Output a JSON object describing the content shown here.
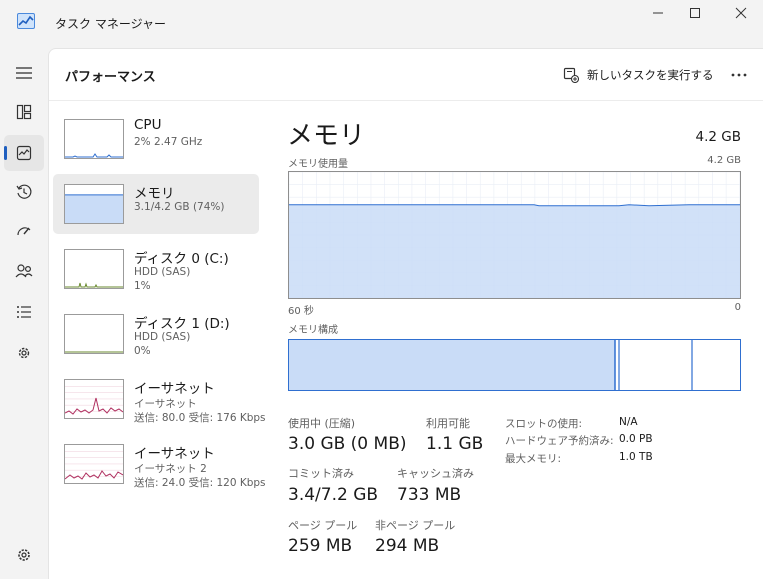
{
  "window": {
    "title": "タスク マネージャー"
  },
  "header": {
    "title": "パフォーマンス",
    "new_task_label": "新しいタスクを実行する"
  },
  "colors": {
    "accent": "#1f5fbf",
    "memory_fill": "#c9dcf7",
    "memory_line": "#2f6fd0",
    "network_line": "#b03060"
  },
  "nav": {
    "items": [
      {
        "icon": "hamburger-menu-icon"
      },
      {
        "icon": "processes-icon"
      },
      {
        "icon": "performance-icon",
        "active": true
      },
      {
        "icon": "app-history-icon"
      },
      {
        "icon": "startup-apps-icon"
      },
      {
        "icon": "users-icon"
      },
      {
        "icon": "details-icon"
      },
      {
        "icon": "services-icon"
      },
      {
        "icon": "settings-icon"
      }
    ]
  },
  "devices": [
    {
      "name": "CPU",
      "sub1": "2%  2.47 GHz",
      "sub2": "",
      "type": "cpu",
      "usage": 0.02
    },
    {
      "name": "メモリ",
      "sub1": "3.1/4.2 GB (74%)",
      "sub2": "",
      "type": "memory",
      "usage": 0.74,
      "selected": true
    },
    {
      "name": "ディスク 0 (C:)",
      "sub1": "HDD (SAS)",
      "sub2": "1%",
      "type": "disk",
      "usage": 0.01
    },
    {
      "name": "ディスク 1 (D:)",
      "sub1": "HDD (SAS)",
      "sub2": "0%",
      "type": "disk",
      "usage": 0.0
    },
    {
      "name": "イーサネット",
      "sub1": "イーサネット",
      "sub2": "送信: 80.0  受信: 176 Kbps",
      "type": "network"
    },
    {
      "name": "イーサネット",
      "sub1": "イーサネット 2",
      "sub2": "送信: 24.0  受信: 120 Kbps",
      "type": "network"
    }
  ],
  "detail": {
    "title": "メモリ",
    "total": "4.2 GB",
    "usage_label": "メモリ使用量",
    "usage_max": "4.2 GB",
    "time_left": "60 秒",
    "time_right": "0",
    "composition_label": "メモリ構成",
    "stats": [
      {
        "label": "使用中 (圧縮)",
        "value": "3.0 GB (0 MB)"
      },
      {
        "label": "利用可能",
        "value": "1.1 GB"
      },
      {
        "label": "コミット済み",
        "value": "3.4/7.2 GB"
      },
      {
        "label": "キャッシュ済み",
        "value": "733 MB"
      },
      {
        "label": "ページ プール",
        "value": "259 MB"
      },
      {
        "label": "非ページ プール",
        "value": "294 MB"
      }
    ],
    "kv": [
      {
        "label": "スロットの使用:",
        "value": "N/A"
      },
      {
        "label": "ハードウェア予約済み:",
        "value": "0.0 PB"
      },
      {
        "label": "最大メモリ:",
        "value": "1.0 TB"
      }
    ]
  }
}
